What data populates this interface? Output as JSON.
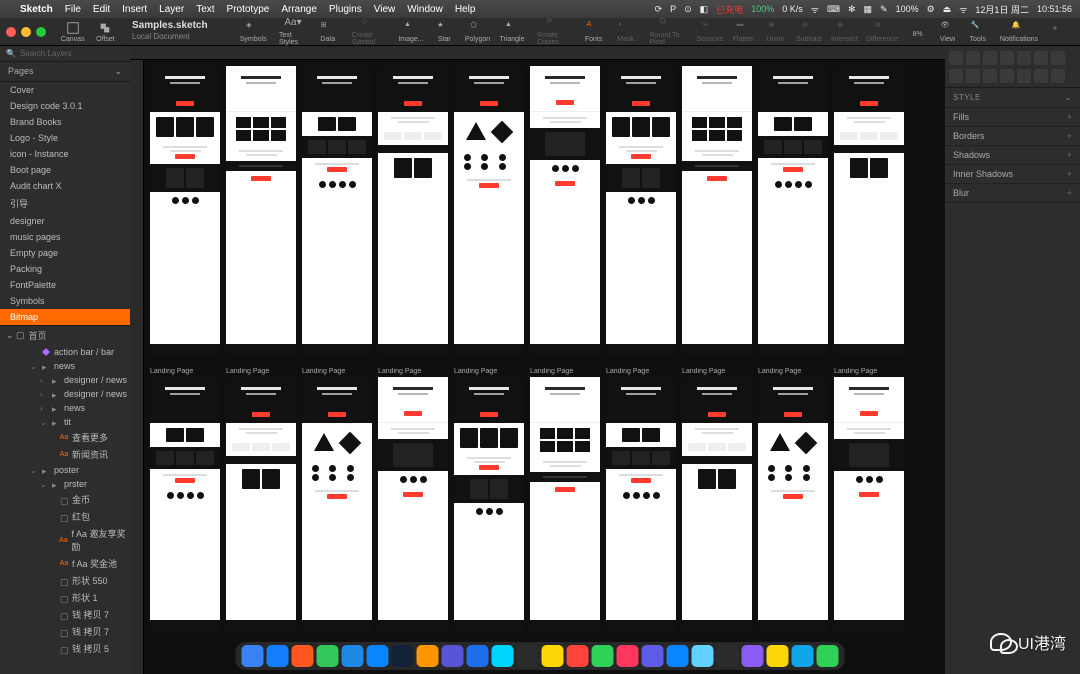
{
  "menubar": {
    "app": "Sketch",
    "items": [
      "File",
      "Edit",
      "Insert",
      "Layer",
      "Text",
      "Prototype",
      "Arrange",
      "Plugins",
      "View",
      "Window",
      "Help"
    ],
    "right": {
      "battery": "100%",
      "charge": "已充电",
      "k": "K/s",
      "date": "12月1日 周二",
      "time": "10:51:56",
      "icons": [
        "⟳",
        "P",
        "⊙",
        "•",
        "◧",
        "☰",
        "⌨",
        "✻",
        "▦",
        "✎",
        "⚙",
        "⏏",
        "ᯤ",
        "⊡",
        "🔋"
      ]
    }
  },
  "toolbar": {
    "doc_title": "Samples.sketch",
    "doc_sub": "Local Document",
    "buttons": [
      "Canvas",
      "Offset",
      "",
      "Symbols",
      "Text Styles",
      "Data",
      "",
      "Create Symbol",
      "Image...",
      "Star",
      "Polygon",
      "Triangle",
      "Rotate Copies",
      "",
      "Fonts",
      "Mask",
      "Round To Pixel",
      "Scissors",
      "Flatten",
      "Union",
      "Subtract",
      "Intersect",
      "Difference"
    ],
    "right": {
      "zoom": "8%",
      "view": "View",
      "tools": "Tools",
      "notifications": "Notifications"
    }
  },
  "sidebar": {
    "search_placeholder": "Search Layers",
    "pages_label": "Pages",
    "pages": [
      "Cover",
      "Design code 3.0.1",
      "Brand Books",
      "Logo - Style",
      "icon - Instance",
      "Boot page",
      "Audit chart X",
      "引导",
      "designer",
      "music pages",
      "Empty page",
      "Packing",
      "FontPalette",
      "Symbols",
      "Bitmap"
    ],
    "selected_page": "Bitmap",
    "root_layer": "首页",
    "layers": [
      {
        "t": "action bar / bar",
        "i": "diamond",
        "d": 1
      },
      {
        "t": "news",
        "i": "folder",
        "d": 1,
        "open": true
      },
      {
        "t": "designer / news",
        "i": "folder",
        "d": 2
      },
      {
        "t": "designer / news",
        "i": "folder",
        "d": 2
      },
      {
        "t": "news",
        "i": "folder",
        "d": 2
      },
      {
        "t": "tit",
        "i": "folder",
        "d": 2,
        "open": true
      },
      {
        "t": "查看更多",
        "i": "txt",
        "d": 3
      },
      {
        "t": "新闻资讯",
        "i": "txt",
        "d": 3
      },
      {
        "t": "poster",
        "i": "folder",
        "d": 1,
        "open": true
      },
      {
        "t": "prster",
        "i": "folder",
        "d": 2,
        "open": true
      },
      {
        "t": "金币",
        "i": "shape",
        "d": 3
      },
      {
        "t": "红包",
        "i": "shape",
        "d": 3
      },
      {
        "t": "邀友享奖励",
        "i": "txt",
        "d": 3,
        "pre": "f Aa"
      },
      {
        "t": "奖金池",
        "i": "txt",
        "d": 3,
        "pre": "f Aa"
      },
      {
        "t": "形状 550",
        "i": "shape",
        "d": 3
      },
      {
        "t": "形状 1",
        "i": "shape",
        "d": 3
      },
      {
        "t": "钱 拷贝 7",
        "i": "shape",
        "d": 3
      },
      {
        "t": "钱 拷贝 7",
        "i": "shape",
        "d": 3
      },
      {
        "t": "钱 拷贝 5",
        "i": "shape",
        "d": 3
      }
    ]
  },
  "canvas": {
    "row1_titles": [
      "",
      "",
      "",
      "",
      "",
      "",
      "",
      "",
      "",
      ""
    ],
    "row2_title": "Landing Page"
  },
  "inspector": {
    "style": "STYLE",
    "sections": [
      "Fills",
      "Borders",
      "Shadows",
      "Inner Shadows",
      "Blur"
    ]
  },
  "watermark": "UI港湾",
  "dock_colors": [
    "#3b82f6",
    "#147efb",
    "#ff5722",
    "#34c759",
    "#1e88e5",
    "#0a84ff",
    "#132238",
    "#ff9500",
    "#5856d6",
    "#1f6feb",
    "#00d4ff",
    "#2b2b2b",
    "#ffd60a",
    "#ff453a",
    "#30d158",
    "#ff375f",
    "#5e5ce6",
    "#0a84ff",
    "#64d2ff",
    "#2c2c2e",
    "#8b5cf6",
    "#ffd60a",
    "#0ea5e9",
    "#30d158"
  ]
}
